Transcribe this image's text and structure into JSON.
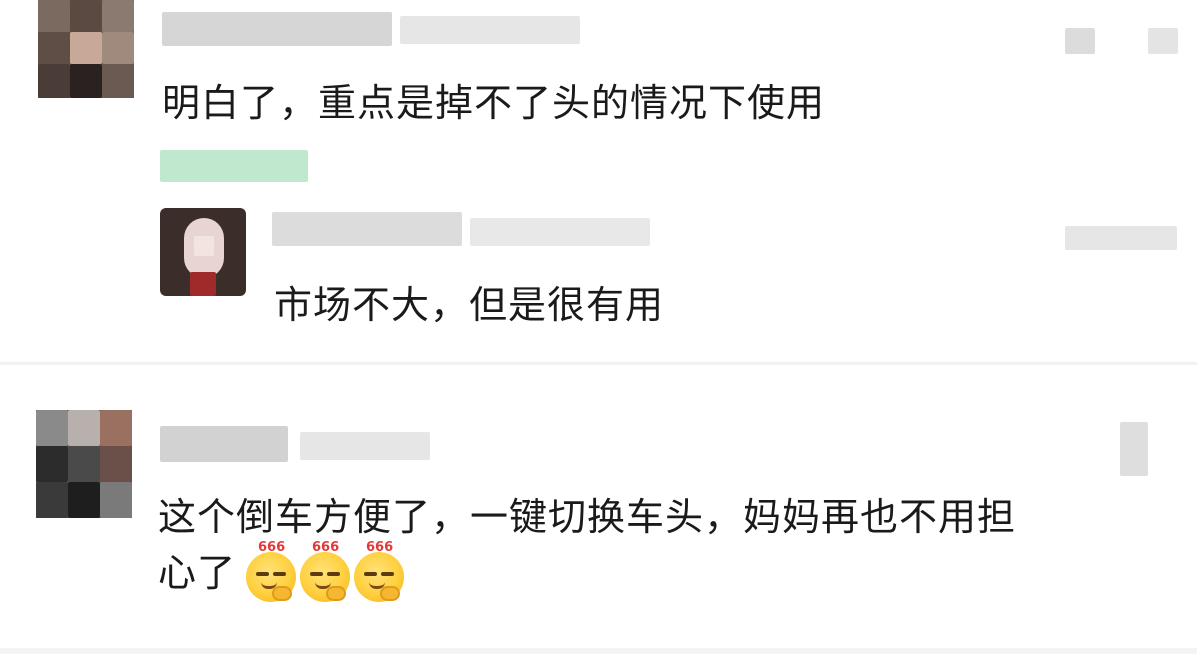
{
  "comments": [
    {
      "text": "明白了，重点是掉不了头的情况下使用",
      "reply": {
        "text": "市场不大，但是很有用"
      }
    },
    {
      "text_line1": "这个倒车方便了，一键切换车头，妈妈再也不用担",
      "text_line2": "心了",
      "emojis": [
        {
          "icon": "smirk-666-emoji",
          "tag": "666"
        },
        {
          "icon": "smirk-666-emoji",
          "tag": "666"
        },
        {
          "icon": "smirk-666-emoji",
          "tag": "666"
        }
      ]
    }
  ],
  "colors": {
    "redacted_gray": "#d9d9d9",
    "redacted_green": "#bfe8cf",
    "text": "#1a1a1a",
    "divider": "#f2f2f2"
  }
}
